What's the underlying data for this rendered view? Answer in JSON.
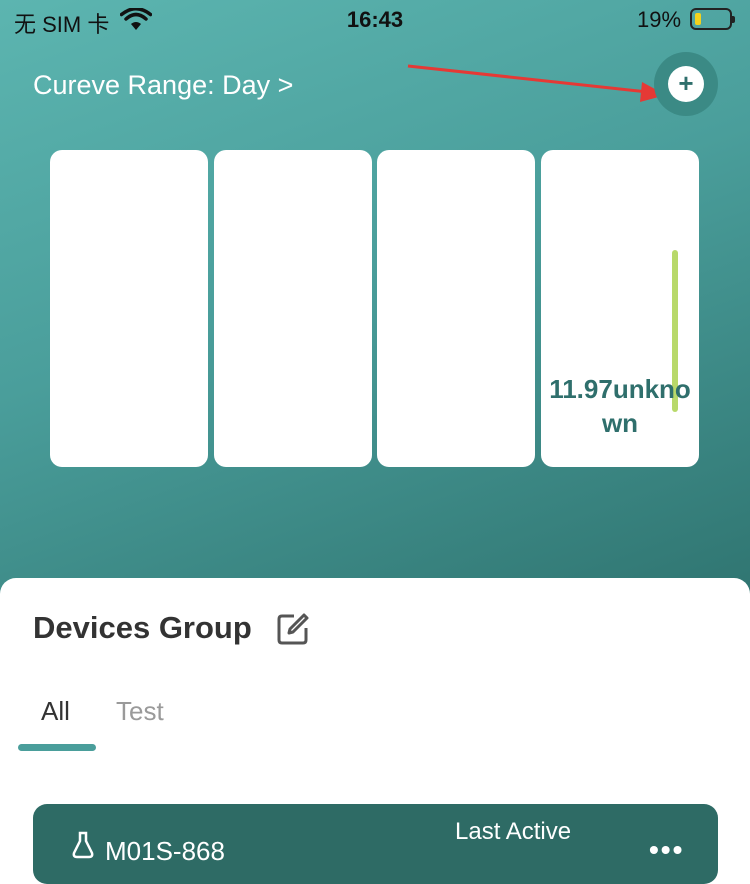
{
  "status_bar": {
    "carrier": "无 SIM 卡",
    "time": "16:43",
    "battery_percent": "19%",
    "battery_level": 0.19
  },
  "header": {
    "range_label": "Cureve Range: Day >",
    "add_button_icon": "plus-icon"
  },
  "cards": [
    {
      "value": ""
    },
    {
      "value": ""
    },
    {
      "value": ""
    },
    {
      "value": "11.97unknown"
    }
  ],
  "devices_group": {
    "title": "Devices Group",
    "edit_icon": "edit-icon",
    "tabs": [
      {
        "label": "All",
        "active": true
      },
      {
        "label": "Test",
        "active": false
      }
    ]
  },
  "device": {
    "name": "M01S-868",
    "last_active_label": "Last Active",
    "more_icon": "more-icon"
  },
  "colors": {
    "accent": "#4a9e9b",
    "device_card": "#2e6b65",
    "value_text": "#2f6f6c",
    "annotation_arrow": "#e53935"
  }
}
